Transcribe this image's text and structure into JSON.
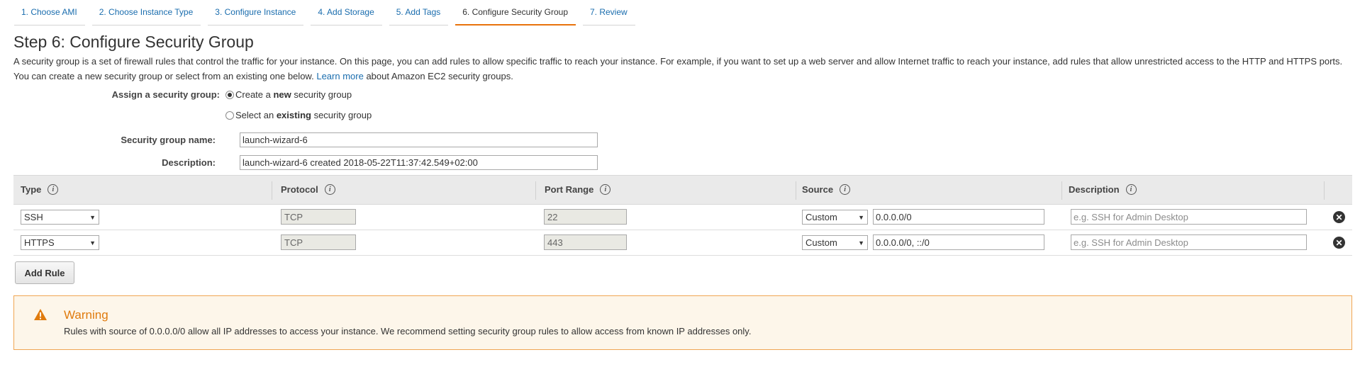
{
  "tabs": [
    {
      "label": "1. Choose AMI"
    },
    {
      "label": "2. Choose Instance Type"
    },
    {
      "label": "3. Configure Instance"
    },
    {
      "label": "4. Add Storage"
    },
    {
      "label": "5. Add Tags"
    },
    {
      "label": "6. Configure Security Group",
      "active": true
    },
    {
      "label": "7. Review"
    }
  ],
  "page_title": "Step 6: Configure Security Group",
  "intro": {
    "text_before_link": "A security group is a set of firewall rules that control the traffic for your instance. On this page, you can add rules to allow specific traffic to reach your instance. For example, if you want to set up a web server and allow Internet traffic to reach your instance, add rules that allow unrestricted access to the HTTP and HTTPS ports. You can create a new security group or select from an existing one below.",
    "link": "Learn more",
    "text_after_link": "about Amazon EC2 security groups."
  },
  "assign": {
    "label": "Assign a security group:",
    "option_new_pre": "Create a ",
    "option_new_bold": "new",
    "option_new_post": " security group",
    "option_existing_pre": "Select an ",
    "option_existing_bold": "existing",
    "option_existing_post": " security group",
    "selected": "new"
  },
  "group_name": {
    "label": "Security group name:",
    "value": "launch-wizard-6"
  },
  "description": {
    "label": "Description:",
    "value": "launch-wizard-6 created 2018-05-22T11:37:42.549+02:00"
  },
  "table": {
    "headers": {
      "type": "Type",
      "protocol": "Protocol",
      "port_range": "Port Range",
      "source": "Source",
      "description": "Description"
    },
    "info_glyph": "i",
    "rows": [
      {
        "type": "SSH",
        "protocol": "TCP",
        "port": "22",
        "source_mode": "Custom",
        "source_value": "0.0.0.0/0",
        "description_placeholder": "e.g. SSH for Admin Desktop"
      },
      {
        "type": "HTTPS",
        "protocol": "TCP",
        "port": "443",
        "source_mode": "Custom",
        "source_value": "0.0.0.0/0, ::/0",
        "description_placeholder": "e.g. SSH for Admin Desktop"
      }
    ],
    "remove_glyph": "✕"
  },
  "add_rule_label": "Add Rule",
  "warning": {
    "title": "Warning",
    "message": "Rules with source of 0.0.0.0/0 allow all IP addresses to access your instance. We recommend setting security group rules to allow access from known IP addresses only.",
    "color": "#e07b0e"
  },
  "colors": {
    "link": "#1a6dae",
    "active_tab_underline": "#e8720c",
    "warning_border": "#f0a654",
    "warning_bg": "#fdf6ea"
  },
  "icons": [
    "info-icon",
    "remove-rule-icon",
    "warning-triangle-icon",
    "dropdown-arrow-icon"
  ]
}
